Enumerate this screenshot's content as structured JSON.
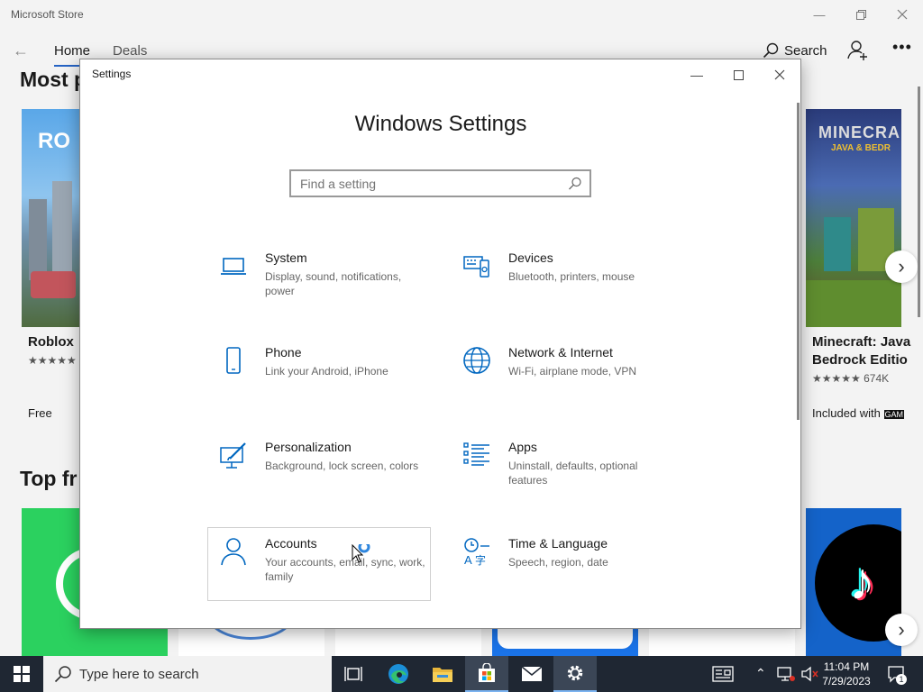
{
  "store": {
    "title": "Microsoft Store",
    "tabs": [
      "Home",
      "Deals"
    ],
    "search_label": "Search",
    "sections": [
      "Most p",
      "Top fr"
    ],
    "cards": [
      {
        "title": "Roblox",
        "rating": "★★★★★",
        "price": "Free"
      },
      {
        "title": "Minecraft: Java",
        "title2": "Bedrock Editio",
        "rating": "★★★★★ 674K",
        "price": "Included with",
        "badge": "GAM"
      }
    ]
  },
  "settings": {
    "window_title": "Settings",
    "heading": "Windows Settings",
    "search_placeholder": "Find a setting",
    "items": [
      {
        "name": "System",
        "desc": "Display, sound, notifications, power",
        "icon": "laptop-icon"
      },
      {
        "name": "Devices",
        "desc": "Bluetooth, printers, mouse",
        "icon": "devices-icon"
      },
      {
        "name": "Phone",
        "desc": "Link your Android, iPhone",
        "icon": "phone-icon"
      },
      {
        "name": "Network & Internet",
        "desc": "Wi-Fi, airplane mode, VPN",
        "icon": "globe-icon"
      },
      {
        "name": "Personalization",
        "desc": "Background, lock screen, colors",
        "icon": "paintbrush-icon"
      },
      {
        "name": "Apps",
        "desc": "Uninstall, defaults, optional features",
        "icon": "apps-list-icon"
      },
      {
        "name": "Accounts",
        "desc": "Your accounts, email, sync, work, family",
        "icon": "person-icon"
      },
      {
        "name": "Time & Language",
        "desc": "Speech, region, date",
        "icon": "time-language-icon"
      }
    ]
  },
  "taskbar": {
    "search_text": "Type here to search",
    "time": "11:04 PM",
    "date": "7/29/2023",
    "notification_count": "1"
  },
  "colors": {
    "accent": "#0067c0",
    "taskbar": "#1f2733"
  }
}
